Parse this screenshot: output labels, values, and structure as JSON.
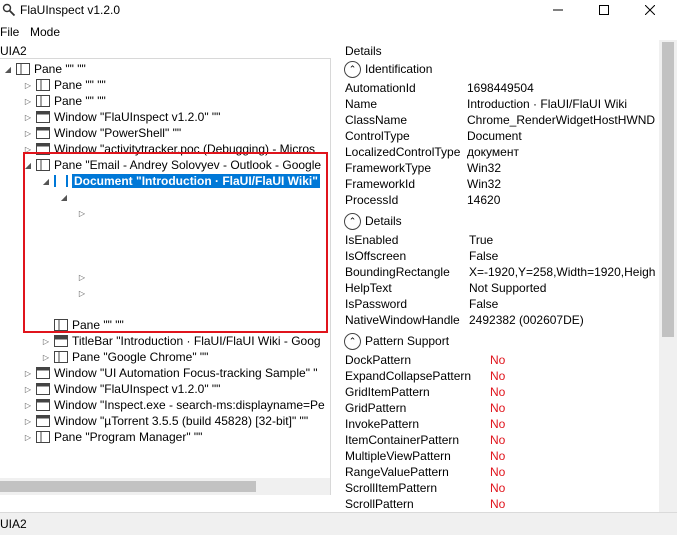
{
  "window": {
    "title": "FlaUInspect v1.2.0",
    "min_icon": "minimize-icon",
    "max_icon": "maximize-icon",
    "close_icon": "close-icon"
  },
  "menu": {
    "file": "File",
    "mode": "Mode"
  },
  "left_panel": {
    "label": "UIA2",
    "tree": [
      {
        "label": "Pane \"\" \"\"",
        "icon": "pane-icon",
        "expander": "expanded"
      },
      {
        "label": "Pane \"\" \"\"",
        "icon": "pane-icon",
        "expander": "collapsed"
      },
      {
        "label": "Pane \"\" \"\"",
        "icon": "pane-icon",
        "expander": "collapsed"
      },
      {
        "label": "Window \"FlaUInspect v1.2.0\" \"\"",
        "icon": "window-icon",
        "expander": "collapsed"
      },
      {
        "label": "Window \"PowerShell\" \"\"",
        "icon": "window-icon",
        "expander": "collapsed"
      },
      {
        "label": "Window \"activitytracker.poc (Debugging) - Micros",
        "icon": "window-icon",
        "expander": "collapsed"
      },
      {
        "label": "Pane \"Email - Andrey Solovyev - Outlook - Google",
        "icon": "pane-icon",
        "expander": "expanded"
      },
      {
        "label": "Document \"Introduction · FlaUI/FlaUI Wiki\"",
        "icon": "document-icon",
        "expander": "expanded",
        "selected": true
      },
      {
        "label": "",
        "icon": "",
        "expander": "expanded"
      },
      {
        "label": "",
        "icon": "",
        "expander": "collapsed"
      },
      {
        "label": "",
        "icon": "",
        "expander": "collapsed"
      },
      {
        "label": "",
        "icon": "",
        "expander": "collapsed"
      },
      {
        "label": "Pane \"\" \"\"",
        "icon": "pane-icon",
        "expander": "none"
      },
      {
        "label": "TitleBar \"Introduction · FlaUI/FlaUI Wiki - Goog",
        "icon": "titlebar-icon",
        "expander": "collapsed"
      },
      {
        "label": "Pane \"Google Chrome\" \"\"",
        "icon": "pane-icon",
        "expander": "collapsed"
      },
      {
        "label": "Window \"UI Automation Focus-tracking Sample\" \"",
        "icon": "window-icon",
        "expander": "collapsed"
      },
      {
        "label": "Window \"FlaUInspect v1.2.0\" \"\"",
        "icon": "window-icon",
        "expander": "collapsed"
      },
      {
        "label": "Window \"Inspect.exe - search-ms:displayname=Pe",
        "icon": "window-icon",
        "expander": "collapsed"
      },
      {
        "label": "Window \"µTorrent 3.5.5  (build 45828) [32-bit]\" \"\"",
        "icon": "window-icon",
        "expander": "collapsed"
      },
      {
        "label": "Pane \"Program Manager\" \"\"",
        "icon": "pane-icon",
        "expander": "collapsed"
      }
    ]
  },
  "right_panel": {
    "label": "Details",
    "sections": {
      "identification": {
        "title": "Identification",
        "rows": [
          {
            "key": "AutomationId",
            "value": "1698449504"
          },
          {
            "key": "Name",
            "value": "Introduction · FlaUI/FlaUI Wiki"
          },
          {
            "key": "ClassName",
            "value": "Chrome_RenderWidgetHostHWND"
          },
          {
            "key": "ControlType",
            "value": "Document"
          },
          {
            "key": "LocalizedControlType",
            "value": "документ"
          },
          {
            "key": "FrameworkType",
            "value": "Win32"
          },
          {
            "key": "FrameworkId",
            "value": "Win32"
          },
          {
            "key": "ProcessId",
            "value": "14620"
          }
        ]
      },
      "details": {
        "title": "Details",
        "rows": [
          {
            "key": "IsEnabled",
            "value": "True"
          },
          {
            "key": "IsOffscreen",
            "value": "False"
          },
          {
            "key": "BoundingRectangle",
            "value": "X=-1920,Y=258,Width=1920,Heigh"
          },
          {
            "key": "HelpText",
            "value": "Not Supported"
          },
          {
            "key": "IsPassword",
            "value": "False"
          },
          {
            "key": "NativeWindowHandle",
            "value": "2492382 (002607DE)"
          }
        ]
      },
      "patterns": {
        "title": "Pattern Support",
        "rows": [
          {
            "key": "DockPattern",
            "value": "No"
          },
          {
            "key": "ExpandCollapsePattern",
            "value": "No"
          },
          {
            "key": "GridItemPattern",
            "value": "No"
          },
          {
            "key": "GridPattern",
            "value": "No"
          },
          {
            "key": "InvokePattern",
            "value": "No"
          },
          {
            "key": "ItemContainerPattern",
            "value": "No"
          },
          {
            "key": "MultipleViewPattern",
            "value": "No"
          },
          {
            "key": "RangeValuePattern",
            "value": "No"
          },
          {
            "key": "ScrollItemPattern",
            "value": "No"
          },
          {
            "key": "ScrollPattern",
            "value": "No"
          }
        ]
      }
    }
  },
  "status": {
    "text": "UIA2"
  },
  "colors": {
    "selection": "#0078d7",
    "highlight_border": "#e0141c",
    "no_value": "#e0141c"
  }
}
